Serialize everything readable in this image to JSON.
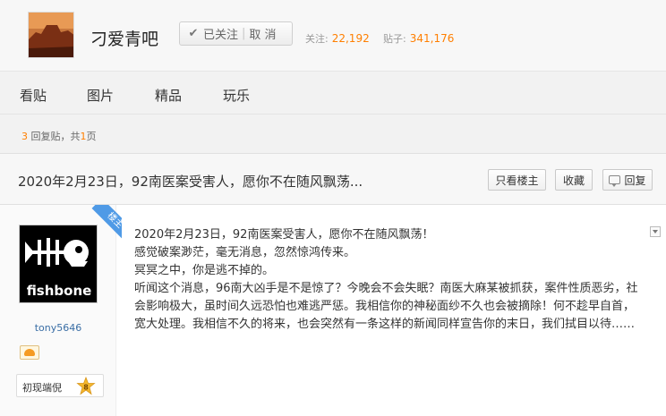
{
  "header": {
    "forum_name": "刁爱青吧",
    "follow_label": "已关注",
    "unfollow_label": "取 消",
    "followers_label": "关注:",
    "followers_count": "22,192",
    "posts_label": "贴子:",
    "posts_count": "341,176"
  },
  "nav": {
    "items": [
      "看贴",
      "图片",
      "精品",
      "玩乐"
    ]
  },
  "reply_info": {
    "reply_count": "3",
    "reply_label": "回复贴，共",
    "page_count": "1",
    "page_label": "页"
  },
  "thread": {
    "title": "2020年2月23日，92南医案受害人，愿你不在随风飘荡...",
    "only_author_label": "只看楼主",
    "favorite_label": "收藏",
    "reply_label": "回复"
  },
  "post": {
    "badge": "楼主",
    "author_name": "tony5646",
    "avatar_text": "fishbone",
    "rank_title": "初现端倪",
    "rank_level": "8",
    "lines": [
      "2020年2月23日，92南医案受害人，愿你不在随风飘荡！",
      "感觉破案渺茫，毫无消息，忽然惊鸿传来。",
      "冥冥之中，你是逃不掉的。",
      "听闻这个消息，96南大凶手是不是惊了？今晚会不会失眠？南医大麻某被抓获，案件性质恶劣，社会影响极大，虽时间久远恐怕也难逃严惩。我相信你的神秘面纱不久也会被摘除！何不趁早自首，宽大处理。我相信不久的将来，也会突然有一条这样的新闻同样宣告你的末日，我们拭目以待……"
    ]
  },
  "colors": {
    "accent_orange": "#ff7f00",
    "link_blue": "#3a6ea5",
    "badge_blue": "#4f9ae6"
  }
}
